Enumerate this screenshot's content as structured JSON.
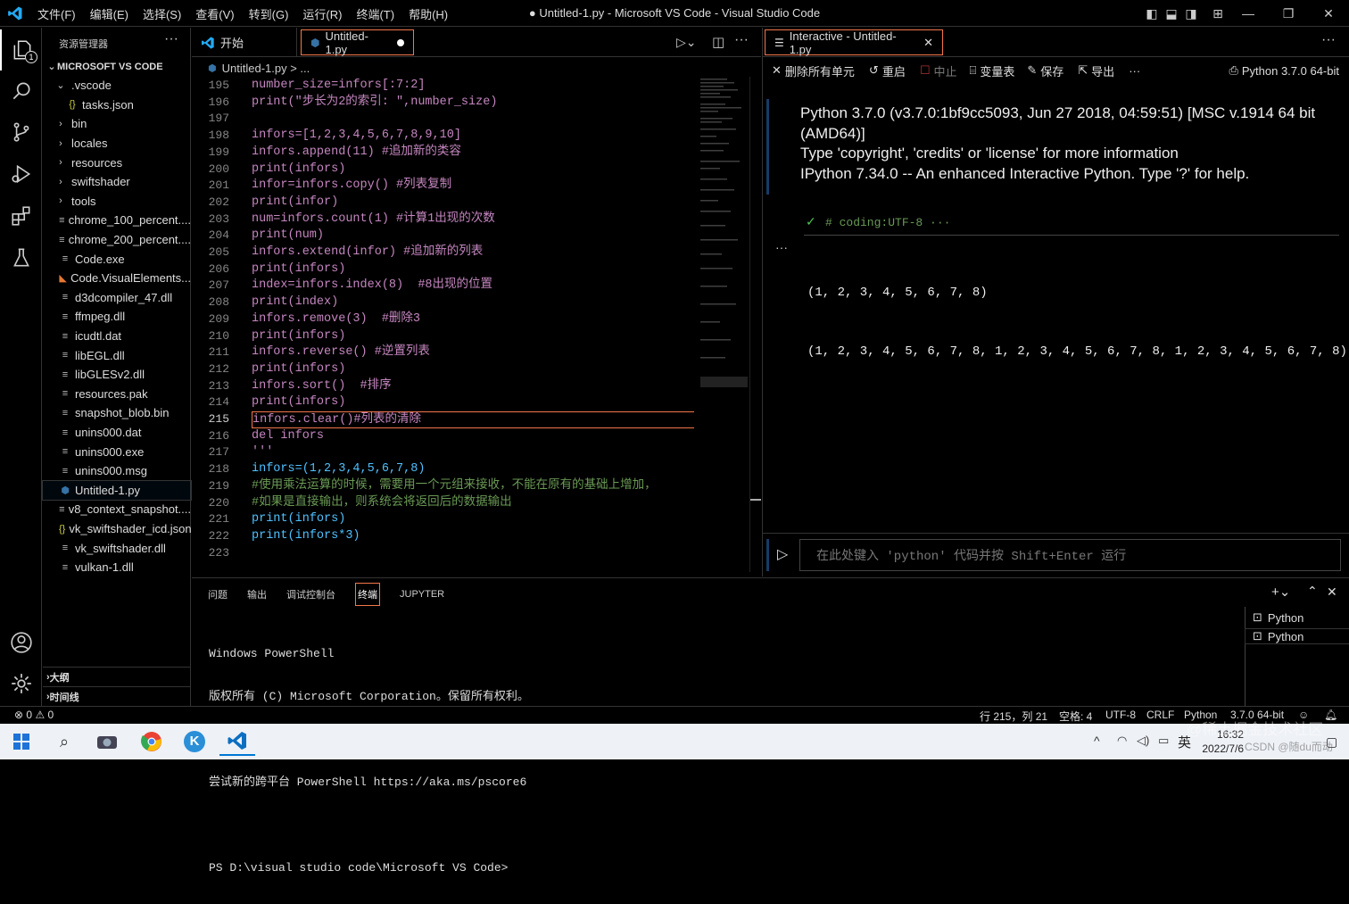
{
  "window": {
    "title": "● Untitled-1.py - Microsoft VS Code - Visual Studio Code",
    "menus": [
      "文件(F)",
      "编辑(E)",
      "选择(S)",
      "查看(V)",
      "转到(G)",
      "运行(R)",
      "终端(T)",
      "帮助(H)"
    ]
  },
  "activity_badge": "1",
  "explorer": {
    "header": "资源管理器",
    "root": "MICROSOFT VS CODE",
    "items": [
      {
        "label": ".vscode",
        "kind": "folder-open",
        "depth": 0
      },
      {
        "label": "tasks.json",
        "kind": "json",
        "depth": 1
      },
      {
        "label": "bin",
        "kind": "folder",
        "depth": 0
      },
      {
        "label": "locales",
        "kind": "folder",
        "depth": 0
      },
      {
        "label": "resources",
        "kind": "folder",
        "depth": 0
      },
      {
        "label": "swiftshader",
        "kind": "folder",
        "depth": 0
      },
      {
        "label": "tools",
        "kind": "folder",
        "depth": 0
      },
      {
        "label": "chrome_100_percent....",
        "kind": "file",
        "depth": 0
      },
      {
        "label": "chrome_200_percent....",
        "kind": "file",
        "depth": 0
      },
      {
        "label": "Code.exe",
        "kind": "file",
        "depth": 0
      },
      {
        "label": "Code.VisualElements...",
        "kind": "rss",
        "depth": 0
      },
      {
        "label": "d3dcompiler_47.dll",
        "kind": "file",
        "depth": 0
      },
      {
        "label": "ffmpeg.dll",
        "kind": "file",
        "depth": 0
      },
      {
        "label": "icudtl.dat",
        "kind": "file",
        "depth": 0
      },
      {
        "label": "libEGL.dll",
        "kind": "file",
        "depth": 0
      },
      {
        "label": "libGLESv2.dll",
        "kind": "file",
        "depth": 0
      },
      {
        "label": "resources.pak",
        "kind": "file",
        "depth": 0
      },
      {
        "label": "snapshot_blob.bin",
        "kind": "file",
        "depth": 0
      },
      {
        "label": "unins000.dat",
        "kind": "file",
        "depth": 0
      },
      {
        "label": "unins000.exe",
        "kind": "file",
        "depth": 0
      },
      {
        "label": "unins000.msg",
        "kind": "file",
        "depth": 0
      },
      {
        "label": "Untitled-1.py",
        "kind": "python",
        "depth": 0
      },
      {
        "label": "v8_context_snapshot....",
        "kind": "file",
        "depth": 0
      },
      {
        "label": "vk_swiftshader_icd.json",
        "kind": "json",
        "depth": 0
      },
      {
        "label": "vk_swiftshader.dll",
        "kind": "file",
        "depth": 0
      },
      {
        "label": "vulkan-1.dll",
        "kind": "file",
        "depth": 0
      }
    ],
    "outline": "大纲",
    "timeline": "时间线"
  },
  "editor": {
    "tabs": [
      {
        "label": "开始"
      },
      {
        "label": "Untitled-1.py"
      }
    ],
    "breadcrumb": "Untitled-1.py > ...",
    "lines": [
      {
        "n": "195",
        "t": "number_size=infors[:7:2]",
        "c": "p"
      },
      {
        "n": "196",
        "t": "print(\"步长为2的索引: \",number_size)",
        "c": "p"
      },
      {
        "n": "197",
        "t": "",
        "c": "p"
      },
      {
        "n": "198",
        "t": "infors=[1,2,3,4,5,6,7,8,9,10]",
        "c": "p"
      },
      {
        "n": "199",
        "t": "infors.append(11) #追加新的类容",
        "c": "p"
      },
      {
        "n": "200",
        "t": "print(infors)",
        "c": "p"
      },
      {
        "n": "201",
        "t": "infor=infors.copy() #列表复制",
        "c": "p"
      },
      {
        "n": "202",
        "t": "print(infor)",
        "c": "p"
      },
      {
        "n": "203",
        "t": "num=infors.count(1) #计算1出现的次数",
        "c": "p"
      },
      {
        "n": "204",
        "t": "print(num)",
        "c": "p"
      },
      {
        "n": "205",
        "t": "infors.extend(infor) #追加新的列表",
        "c": "p"
      },
      {
        "n": "206",
        "t": "print(infors)",
        "c": "p"
      },
      {
        "n": "207",
        "t": "index=infors.index(8)  #8出现的位置",
        "c": "p"
      },
      {
        "n": "208",
        "t": "print(index)",
        "c": "p"
      },
      {
        "n": "209",
        "t": "infors.remove(3)  #删除3",
        "c": "p"
      },
      {
        "n": "210",
        "t": "print(infors)",
        "c": "p"
      },
      {
        "n": "211",
        "t": "infors.reverse() #逆置列表",
        "c": "p"
      },
      {
        "n": "212",
        "t": "print(infors)",
        "c": "p"
      },
      {
        "n": "213",
        "t": "infors.sort()  #排序",
        "c": "p"
      },
      {
        "n": "214",
        "t": "print(infors)",
        "c": "p"
      },
      {
        "n": "215",
        "t": "infors.clear()#列表的清除",
        "c": "p"
      },
      {
        "n": "216",
        "t": "del infors",
        "c": "p"
      },
      {
        "n": "217",
        "t": "'''",
        "c": "p"
      },
      {
        "n": "218",
        "t": "infors=(1,2,3,4,5,6,7,8)",
        "c": "b"
      },
      {
        "n": "219",
        "t": "#使用乘法运算的时候，需要用一个元组来接收，不能在原有的基础上增加，",
        "c": "g"
      },
      {
        "n": "220",
        "t": "#如果是直接输出，则系统会将返回后的数据输出",
        "c": "g"
      },
      {
        "n": "221",
        "t": "print(infors)",
        "c": "b"
      },
      {
        "n": "222",
        "t": "print(infors*3)",
        "c": "b"
      },
      {
        "n": "223",
        "t": "",
        "c": "b"
      }
    ]
  },
  "interactive": {
    "tab": "Interactive - Untitled-1.py",
    "toolbar": {
      "clear": "删除所有单元",
      "restart": "重启",
      "interrupt": "中止",
      "variables": "变量表",
      "save": "保存",
      "export": "导出",
      "kernel": "Python 3.7.0 64-bit"
    },
    "banner": [
      "Python 3.7.0 (v3.7.0:1bf9cc5093, Jun 27 2018, 04:59:51) [MSC v.1914 64 bit",
      "(AMD64)]",
      "Type 'copyright', 'credits' or 'license' for more information",
      "IPython 7.34.0 -- An enhanced Interactive Python. Type '?' for help."
    ],
    "cell_code": "# coding:UTF-8 ···",
    "output": [
      "(1, 2, 3, 4, 5, 6, 7, 8)",
      "(1, 2, 3, 4, 5, 6, 7, 8, 1, 2, 3, 4, 5, 6, 7, 8, 1, 2, 3, 4, 5, 6, 7, 8)"
    ],
    "input_placeholder": "在此处键入 'python' 代码并按 Shift+Enter 运行"
  },
  "panel": {
    "tabs": [
      "问题",
      "输出",
      "调试控制台",
      "终端",
      "JUPYTER"
    ],
    "active_tab": "终端",
    "terminal": [
      "Windows PowerShell",
      "版权所有 (C) Microsoft Corporation。保留所有权利。",
      "",
      "尝试新的跨平台 PowerShell https://aka.ms/pscore6",
      "",
      "PS D:\\visual studio code\\Microsoft VS Code>"
    ],
    "terminals": [
      "Python",
      "Python"
    ]
  },
  "status": {
    "errors": "0",
    "warnings": "0",
    "position": "行 215，列 21",
    "spaces": "空格: 4",
    "encoding": "UTF-8",
    "eol": "CRLF",
    "language": "Python",
    "interpreter": "3.7.0 64-bit"
  },
  "taskbar": {
    "time": "16:32",
    "date": "2022/7/6",
    "ime": "英"
  },
  "watermark": {
    "main": "@稀土掘金技术社区",
    "sub": "CSDN @随du而动"
  },
  "colors": {
    "accent": "#007acc",
    "modified": "#ffffff",
    "term_active": "#f3764a"
  }
}
